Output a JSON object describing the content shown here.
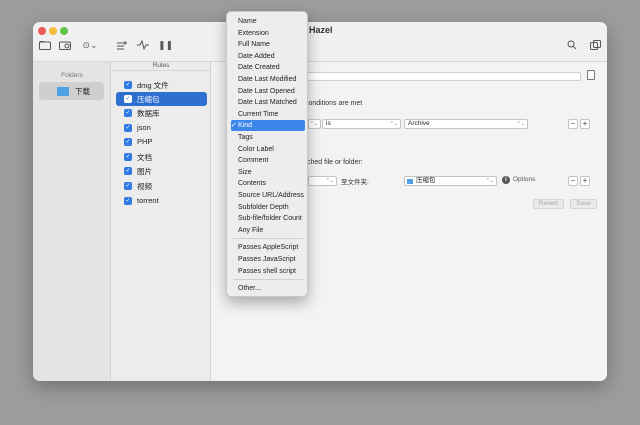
{
  "window": {
    "title": "Hazel"
  },
  "sidebar": {
    "header": "Folders",
    "folders": [
      {
        "label": "下载"
      }
    ]
  },
  "rules": {
    "header": "Rules",
    "items": [
      {
        "label": "dmg 文件",
        "selected": false
      },
      {
        "label": "压缩包",
        "selected": true
      },
      {
        "label": "数据库",
        "selected": false
      },
      {
        "label": "json",
        "selected": false
      },
      {
        "label": "PHP",
        "selected": false
      },
      {
        "label": "文档",
        "selected": false
      },
      {
        "label": "图片",
        "selected": false
      },
      {
        "label": "视频",
        "selected": false
      },
      {
        "label": "torrent",
        "selected": false
      }
    ]
  },
  "main": {
    "conditions_text": "conditions are met",
    "condition": {
      "operator": "is",
      "value": "Archive"
    },
    "actions_text": "ched file or folder:",
    "action": {
      "to_folder_label": "至文件夹:",
      "folder_value": "压缩包",
      "options_label": "Options"
    },
    "revert_label": "Revert",
    "save_label": "Save"
  },
  "menu": {
    "groups": [
      [
        "Name",
        "Extension",
        "Full Name",
        "Date Added",
        "Date Created",
        "Date Last Modified",
        "Date Last Opened",
        "Date Last Matched",
        "Current Time",
        "Kind",
        "Tags",
        "Color Label",
        "Comment",
        "Size",
        "Contents",
        "Source URL/Address",
        "Subfolder Depth",
        "Sub-file/folder Count",
        "Any File"
      ],
      [
        "Passes AppleScript",
        "Passes JavaScript",
        "Passes shell script"
      ],
      [
        "Other..."
      ]
    ],
    "selected": "Kind"
  },
  "colors": {
    "accent": "#2e6fd0",
    "menu_highlight": "#3c86ea"
  }
}
